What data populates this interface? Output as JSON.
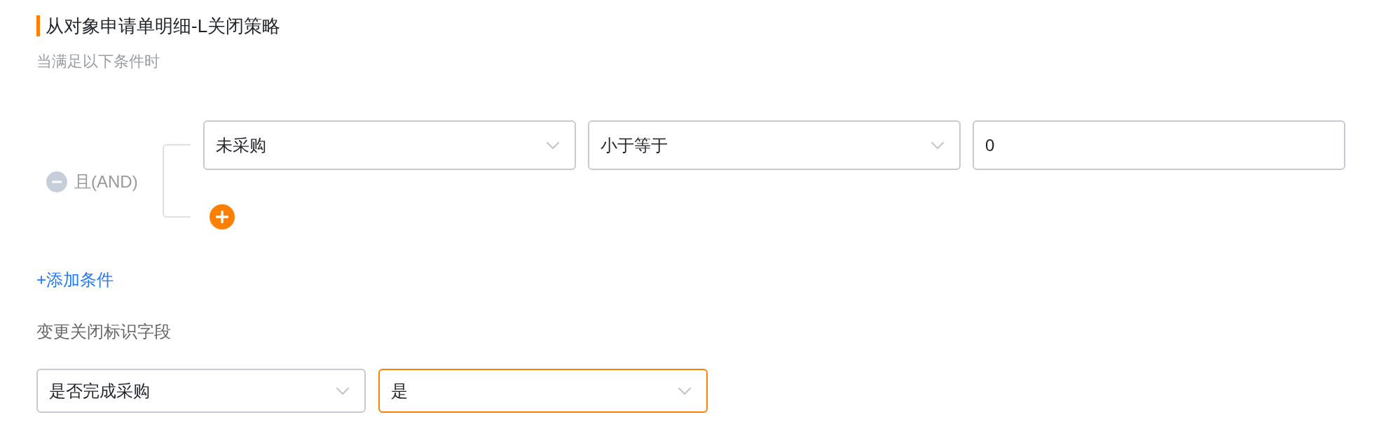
{
  "title": "从对象申请单明细-L关闭策略",
  "subtitle": "当满足以下条件时",
  "condition_group": {
    "logic": "且(AND)",
    "conditions": [
      {
        "fields": [
          {
            "kind": "select",
            "value": "未采购"
          },
          {
            "kind": "select",
            "value": "小于等于"
          },
          {
            "kind": "input",
            "value": "0"
          }
        ]
      }
    ]
  },
  "add_condition": "+添加条件",
  "close_flag": {
    "label": "变更关闭标识字段",
    "fields": [
      {
        "kind": "select",
        "value": "是否完成采购",
        "focused": false
      },
      {
        "kind": "select",
        "value": "是",
        "focused": true
      }
    ]
  }
}
